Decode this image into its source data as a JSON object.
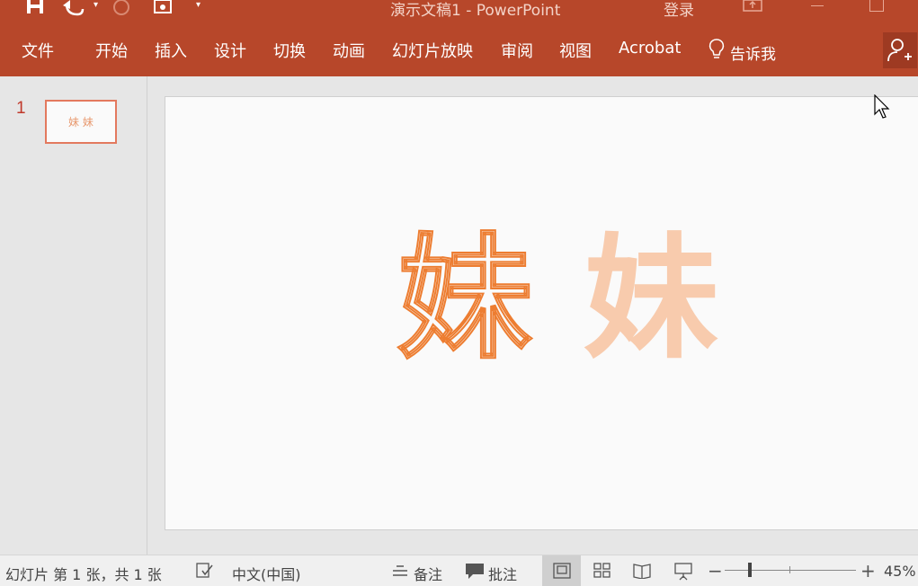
{
  "window": {
    "title": "演示文稿1 - PowerPoint",
    "login": "登录"
  },
  "ribbon": {
    "tabs": [
      "文件",
      "开始",
      "插入",
      "设计",
      "切换",
      "动画",
      "幻灯片放映",
      "审阅",
      "视图",
      "Acrobat"
    ],
    "tell_me": "告诉我"
  },
  "slides_panel": {
    "slide_number": "1",
    "thumb_text": "妹 妹"
  },
  "slide": {
    "char_outline": "妹",
    "char_filled": "妹"
  },
  "status": {
    "slide_info": "幻灯片 第 1 张，共 1 张",
    "language": "中文(中国)",
    "notes": "备注",
    "comments": "批注",
    "zoom": "45%"
  },
  "colors": {
    "accent": "#b7472a",
    "outline_orange": "#ed7d31",
    "filled_peach": "#f8cbad"
  }
}
